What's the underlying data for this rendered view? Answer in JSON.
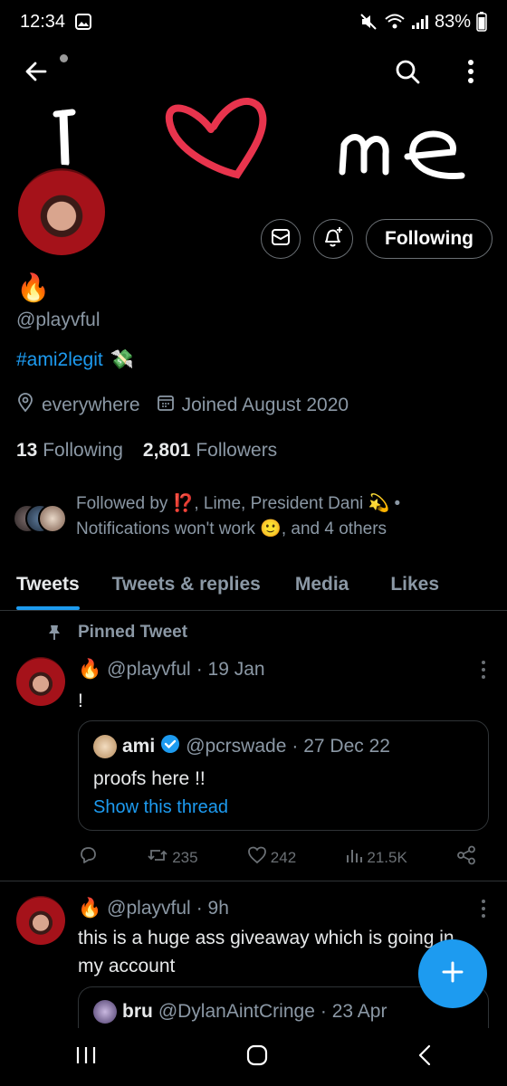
{
  "status_bar": {
    "time": "12:34",
    "battery": "83%"
  },
  "banner": {
    "text_left": "I",
    "text_right": "me",
    "heart_color": "#e8344d"
  },
  "profile": {
    "display_name_emoji": "🔥",
    "handle": "@playvful",
    "bio_hashtag": "#ami2legit",
    "bio_emoji": "💸",
    "location": "everywhere",
    "joined": "Joined August 2020",
    "following_count": "13",
    "following_label": "Following",
    "followers_count": "2,801",
    "followers_label": "Followers",
    "follow_button": "Following"
  },
  "followed_by": {
    "line1": "Followed by ⁉️, Lime, President Dani 💫 •",
    "line2": "Notifications won't work 🙂, and 4 others"
  },
  "tabs": [
    "Tweets",
    "Tweets & replies",
    "Media",
    "Likes"
  ],
  "pinned": {
    "label": "Pinned Tweet",
    "author_emoji": "🔥",
    "handle": "@playvful",
    "date": "· 19 Jan",
    "text": "!",
    "quote": {
      "name": "ami",
      "handle": "@pcrswade",
      "date": "· 27 Dec 22",
      "text": "proofs here !!",
      "link": "Show this thread"
    },
    "retweets": "235",
    "likes": "242",
    "views": "21.5K"
  },
  "tweet2": {
    "author_emoji": "🔥",
    "handle": "@playvful",
    "date": "· 9h",
    "text": "this is a huge ass giveaway which is going in my account",
    "quote": {
      "name": "bru",
      "handle": "@DylanAintCringe",
      "date": "· 23 Apr"
    }
  },
  "colors": {
    "accent": "#1d9bf0",
    "secondary_text": "#8b98a5",
    "border": "#2f3336"
  },
  "icons": [
    "back-arrow-icon",
    "search-icon",
    "more-vertical-icon",
    "mail-icon",
    "bell-plus-icon",
    "location-icon",
    "calendar-icon",
    "pin-icon",
    "reply-icon",
    "retweet-icon",
    "like-icon",
    "views-icon",
    "share-icon",
    "verified-icon",
    "compose-plus-icon"
  ]
}
